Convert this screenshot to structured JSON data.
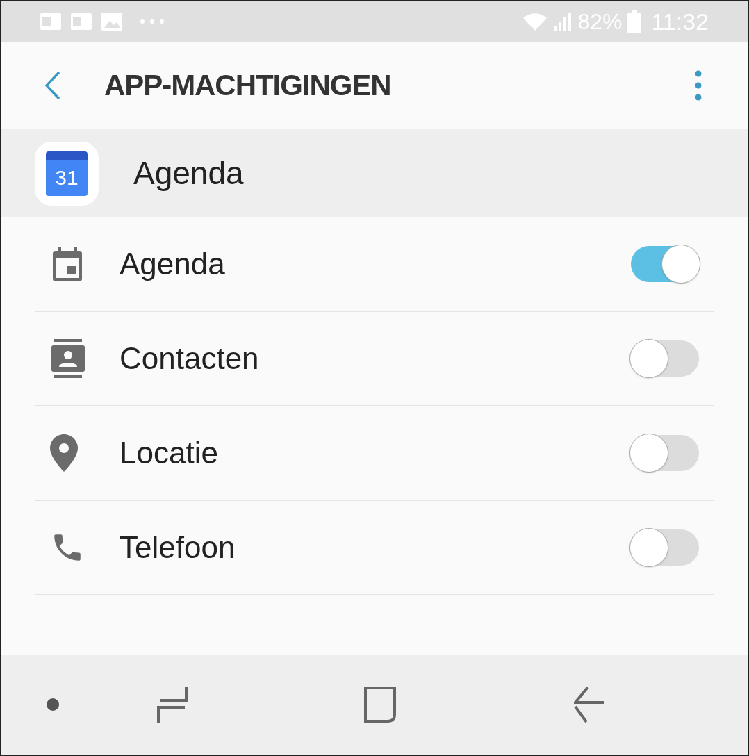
{
  "status_bar": {
    "battery": "82%",
    "time": "11:32"
  },
  "header": {
    "title": "APP-MACHTIGINGEN"
  },
  "app": {
    "name": "Agenda",
    "icon_text": "31"
  },
  "permissions": [
    {
      "kind": "calendar",
      "label": "Agenda",
      "on": true
    },
    {
      "kind": "contacts",
      "label": "Contacten",
      "on": false
    },
    {
      "kind": "location",
      "label": "Locatie",
      "on": false
    },
    {
      "kind": "phone",
      "label": "Telefoon",
      "on": false
    }
  ]
}
